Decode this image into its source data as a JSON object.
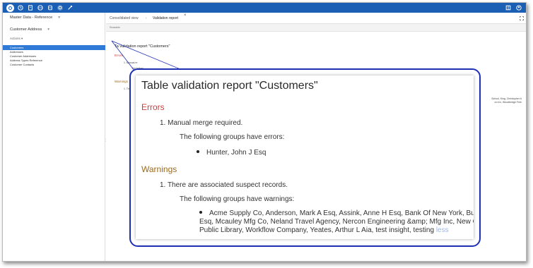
{
  "app": {
    "module_title": "Master Data - Reference",
    "entity_title": "Customer Address",
    "actions_label": "Actions"
  },
  "sidebar": {
    "items": [
      {
        "label": "Customers",
        "active": true
      },
      {
        "label": "Addresses",
        "active": false
      },
      {
        "label": "Customer Addresses",
        "active": false
      },
      {
        "label": "Address Types Reference",
        "active": false
      },
      {
        "label": "Customer Contacts",
        "active": false
      }
    ]
  },
  "tabs": {
    "breadcrumb": "Consolidated view",
    "separator": "›",
    "active": "Validation report",
    "close": "×"
  },
  "toolbar": {
    "label": "Readable"
  },
  "report": {
    "title": "Table validation report \"Customers\"",
    "errors_heading": "Errors",
    "error_item": "1. Manual merge required.",
    "error_groups_intro": "The following groups have errors:",
    "error_groups": "Hunter, John J Esq",
    "warnings_heading": "Warnings",
    "warning_item": "1. There are associated suspect records.",
    "warning_groups_intro": "The following groups have warnings:",
    "warning_line1": "Acme Supply Co, Anderson, Mark A Esq, Assink, Anne H Esq, Bank Of New York, Burrows, J",
    "warning_line2": "Esq, Mcauley Mfg Co, Neland Travel Agency, Nercon Engineering &amp; Mfg Inc, New Custom",
    "warning_line3": "Public Library, Workflow Company, Yeates, Arthur L Aia, test insight, testing",
    "less_link": "less"
  },
  "background_snippets": {
    "title_visible": "Ta  validation report \"Customers\"",
    "errors_label": "Errors",
    "err1": "1. Manual re",
    "err2": "The followi",
    "warnings_label": "Warnings",
    "warn1": "1. Th",
    "right_line1": "School, King, Christopher A",
    "right_line2": "on Inc, Woodbridge Free"
  },
  "colors": {
    "topbar": "#1b5fb5",
    "active_item": "#2f7ad6",
    "errors": "#d23b3b",
    "warnings": "#9a6a1f",
    "callout_border": "#1f2fb3",
    "link": "#9cb6e8"
  }
}
